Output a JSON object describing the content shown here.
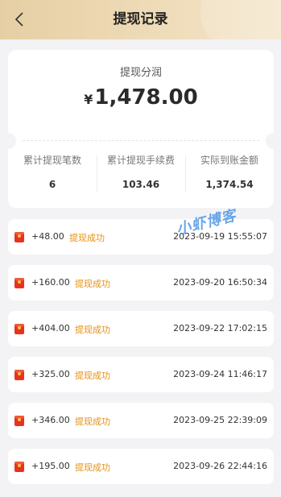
{
  "header": {
    "title": "提现记录",
    "back_icon": "chevron-left-icon"
  },
  "summary": {
    "label": "提现分润",
    "currency": "¥",
    "amount": "1,478.00",
    "stats": [
      {
        "label": "累计提现笔数",
        "value": "6"
      },
      {
        "label": "累计提现手续费",
        "value": "103.46"
      },
      {
        "label": "实际到账金额",
        "value": "1,374.54"
      }
    ]
  },
  "records": [
    {
      "amount": "+48.00",
      "status": "提现成功",
      "time": "2023-09-19 15:55:07"
    },
    {
      "amount": "+160.00",
      "status": "提现成功",
      "time": "2023-09-20 16:50:34"
    },
    {
      "amount": "+404.00",
      "status": "提现成功",
      "time": "2023-09-22 17:02:15"
    },
    {
      "amount": "+325.00",
      "status": "提现成功",
      "time": "2023-09-24 11:46:17"
    },
    {
      "amount": "+346.00",
      "status": "提现成功",
      "time": "2023-09-25 22:39:09"
    },
    {
      "amount": "+195.00",
      "status": "提现成功",
      "time": "2023-09-26 22:44:16"
    }
  ],
  "watermark": "小虾博客",
  "colors": {
    "header": "#e6cfa4",
    "status": "#e8900f",
    "icon": "#e8321f",
    "watermark": "#5096e6"
  }
}
